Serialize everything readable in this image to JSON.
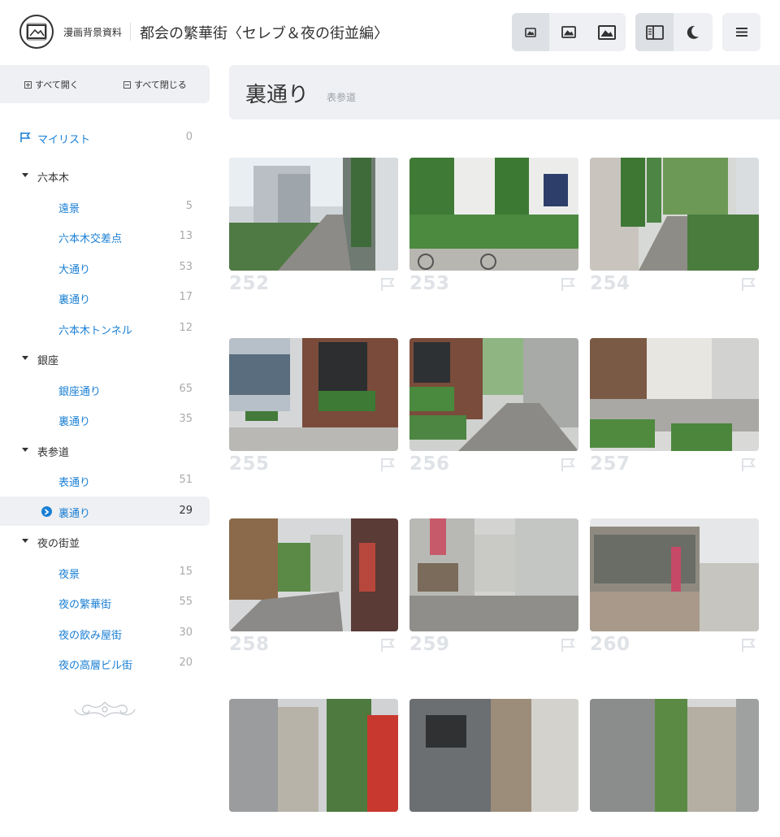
{
  "header": {
    "logo_text": "漫画背景資料",
    "title": "都会の繁華街〈セレブ＆夜の街並編〉",
    "buttons": [
      {
        "name": "size-small-button",
        "icon": "image-small-icon",
        "active": true
      },
      {
        "name": "size-medium-button",
        "icon": "image-medium-icon",
        "active": false
      },
      {
        "name": "size-large-button",
        "icon": "image-large-icon",
        "active": false
      },
      {
        "name": "sidebar-toggle-button",
        "icon": "sidebar-icon",
        "active": true
      },
      {
        "name": "dark-mode-button",
        "icon": "moon-icon",
        "active": false
      },
      {
        "name": "menu-button",
        "icon": "hamburger-icon",
        "active": false
      }
    ]
  },
  "sidebar": {
    "expand_all": "すべて開く",
    "collapse_all": "すべて閉じる",
    "mylist": {
      "label": "マイリスト",
      "count": "0"
    },
    "groups": [
      {
        "label": "六本木",
        "items": [
          {
            "label": "遠景",
            "count": "5"
          },
          {
            "label": "六本木交差点",
            "count": "13"
          },
          {
            "label": "大通り",
            "count": "53"
          },
          {
            "label": "裏通り",
            "count": "17"
          },
          {
            "label": "六本木トンネル",
            "count": "12"
          }
        ]
      },
      {
        "label": "銀座",
        "items": [
          {
            "label": "銀座通り",
            "count": "65"
          },
          {
            "label": "裏通り",
            "count": "35"
          }
        ]
      },
      {
        "label": "表参道",
        "items": [
          {
            "label": "表通り",
            "count": "51"
          },
          {
            "label": "裏通り",
            "count": "29",
            "active": true
          }
        ]
      },
      {
        "label": "夜の街並",
        "items": [
          {
            "label": "夜景",
            "count": "15"
          },
          {
            "label": "夜の繁華街",
            "count": "55"
          },
          {
            "label": "夜の飲み屋街",
            "count": "30"
          },
          {
            "label": "夜の高層ビル街",
            "count": "20"
          }
        ]
      }
    ]
  },
  "main": {
    "title": "裏通り",
    "subtitle": "表参道",
    "photos": [
      {
        "number": "252"
      },
      {
        "number": "253"
      },
      {
        "number": "254"
      },
      {
        "number": "255"
      },
      {
        "number": "256"
      },
      {
        "number": "257"
      },
      {
        "number": "258"
      },
      {
        "number": "259"
      },
      {
        "number": "260"
      },
      {
        "number": ""
      },
      {
        "number": ""
      },
      {
        "number": ""
      }
    ]
  },
  "colors": {
    "accent": "#1a7fd4",
    "panel_bg": "#eef0f3",
    "button_active_bg": "#dde0e5",
    "photo_number": "#dfe2e6"
  }
}
